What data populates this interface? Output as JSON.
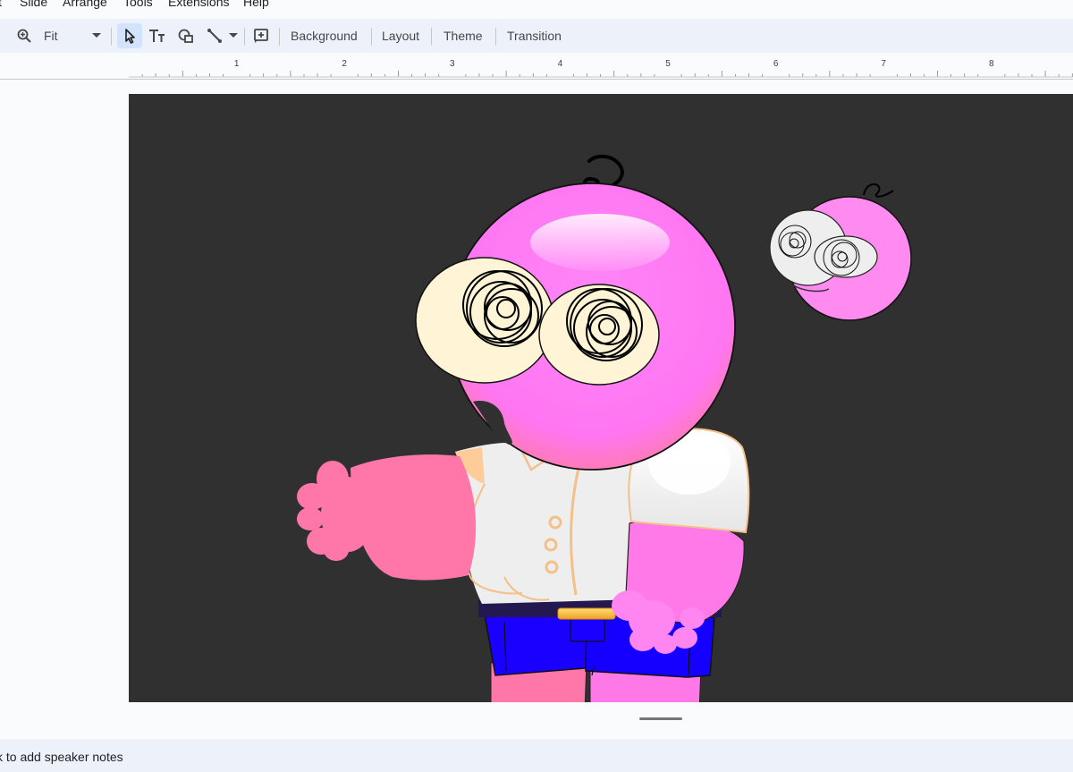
{
  "menu": {
    "items": [
      "t",
      "Slide",
      "Arrange",
      "Tools",
      "Extensions",
      "Help"
    ]
  },
  "toolbar": {
    "zoom_label": "Fit",
    "background_label": "Background",
    "layout_label": "Layout",
    "theme_label": "Theme",
    "transition_label": "Transition"
  },
  "ruler": {
    "labels": [
      "1",
      "2",
      "3",
      "4",
      "5",
      "6",
      "7",
      "8"
    ]
  },
  "notes": {
    "placeholder": "k to add speaker notes"
  },
  "colors": {
    "slide_background": "#303030",
    "toolbar_background": "#edf2fa",
    "active_tool": "#d3e3fd",
    "character_pink": "#ff7cf5",
    "shorts_blue": "#1a00ff"
  }
}
